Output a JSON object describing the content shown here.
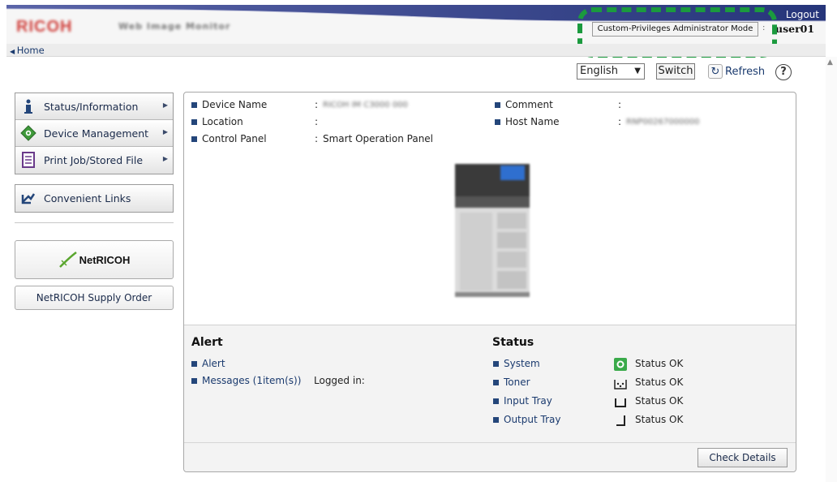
{
  "header": {
    "logo": "RICOH",
    "logo_sub": "Web Image Monitor",
    "logout": "Logout",
    "mode": "Custom-Privileges Administrator Mode",
    "separator": ":",
    "username": "user01"
  },
  "nav": {
    "home": "Home"
  },
  "toolbar": {
    "language": "English",
    "switch": "Switch",
    "refresh": "Refresh",
    "help": "?"
  },
  "sidebar": {
    "items": [
      {
        "label": "Status/Information",
        "icon": "info-icon"
      },
      {
        "label": "Device Management",
        "icon": "device-management-icon"
      },
      {
        "label": "Print Job/Stored File",
        "icon": "document-icon"
      }
    ],
    "convenient_links": "Convenient Links",
    "netricoh_logo": "NetRICOH",
    "supply_order": "NetRICOH Supply Order"
  },
  "device_info": {
    "labels": {
      "device_name": "Device Name",
      "location": "Location",
      "control_panel": "Control Panel",
      "comment": "Comment",
      "host_name": "Host Name"
    },
    "colon": ":",
    "values": {
      "device_name": "RICOH IM C3000 000",
      "location": "",
      "control_panel": "Smart Operation Panel",
      "comment": "",
      "host_name": "RNP00267000000"
    }
  },
  "alert": {
    "title": "Alert",
    "alert_link": "Alert",
    "messages_link": "Messages (1item(s))",
    "logged_in": "Logged in:"
  },
  "status": {
    "title": "Status",
    "rows": [
      {
        "name": "System",
        "value": "Status OK",
        "icon": "system-ok-icon"
      },
      {
        "name": "Toner",
        "value": "Status OK",
        "icon": "toner-icon"
      },
      {
        "name": "Input Tray",
        "value": "Status OK",
        "icon": "input-tray-icon"
      },
      {
        "name": "Output Tray",
        "value": "Status OK",
        "icon": "output-tray-icon"
      }
    ]
  },
  "footer": {
    "check_details": "Check Details"
  },
  "colors": {
    "header_navy": "#26357a",
    "link_blue": "#1a3a6e",
    "highlight_green": "#1b9a3e",
    "logo_red": "#d0403c"
  }
}
